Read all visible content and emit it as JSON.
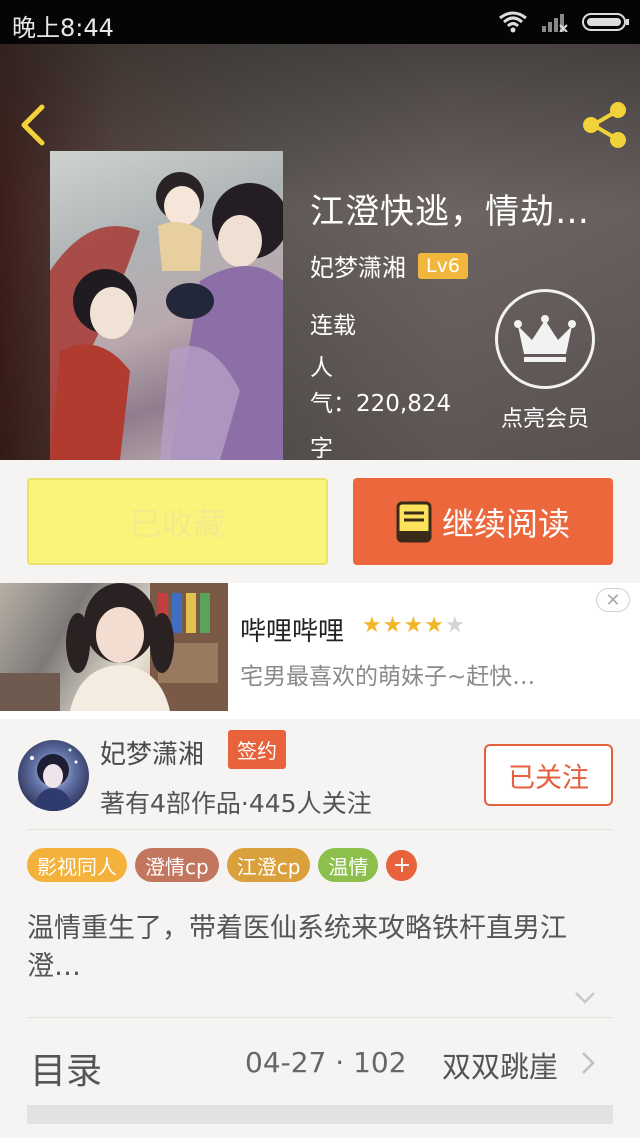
{
  "status_bar": {
    "time": "晚上8:44"
  },
  "book": {
    "title": "江澄快逃，情劫…",
    "author": "妃梦潇湘",
    "author_level": "Lv6",
    "status": "连载",
    "popularity_label": "人气：",
    "popularity": "220,824",
    "words_label": "字",
    "member_label": "点亮会员"
  },
  "actions": {
    "favorite_label": "已收藏",
    "read_label": "继续阅读"
  },
  "ad": {
    "title": "哔哩哔哩",
    "rating": 4,
    "max_rating": 5,
    "description": "宅男最喜欢的萌妹子~赶快…"
  },
  "author_section": {
    "name": "妃梦潇湘",
    "badge": "签约",
    "meta": "著有4部作品·445人关注",
    "follow_label": "已关注"
  },
  "tags": [
    {
      "label": "影视同人",
      "color": "#f4b13b"
    },
    {
      "label": "澄情cp",
      "color": "#c2765e"
    },
    {
      "label": "江澄cp",
      "color": "#d9a03b"
    },
    {
      "label": "温情",
      "color": "#8dbf4c"
    }
  ],
  "tag_add": "+",
  "intro": "温情重生了，带着医仙系统来攻略铁杆直男江澄…",
  "toc": {
    "label": "目录",
    "update": "04-27 · 102",
    "latest_chapter": "双双跳崖"
  },
  "colors": {
    "accent": "#ec673c",
    "favorite": "#fbf47a",
    "level_badge": "#f0b73c"
  },
  "icons": {
    "back": "back-icon",
    "share": "share-icon",
    "crown": "crown-icon",
    "book": "book-icon",
    "wifi": "wifi-icon",
    "signal": "signal-icon",
    "battery": "battery-icon",
    "close": "close-icon",
    "expand": "chevron-down-icon",
    "toc_arrow": "chevron-right-icon"
  }
}
